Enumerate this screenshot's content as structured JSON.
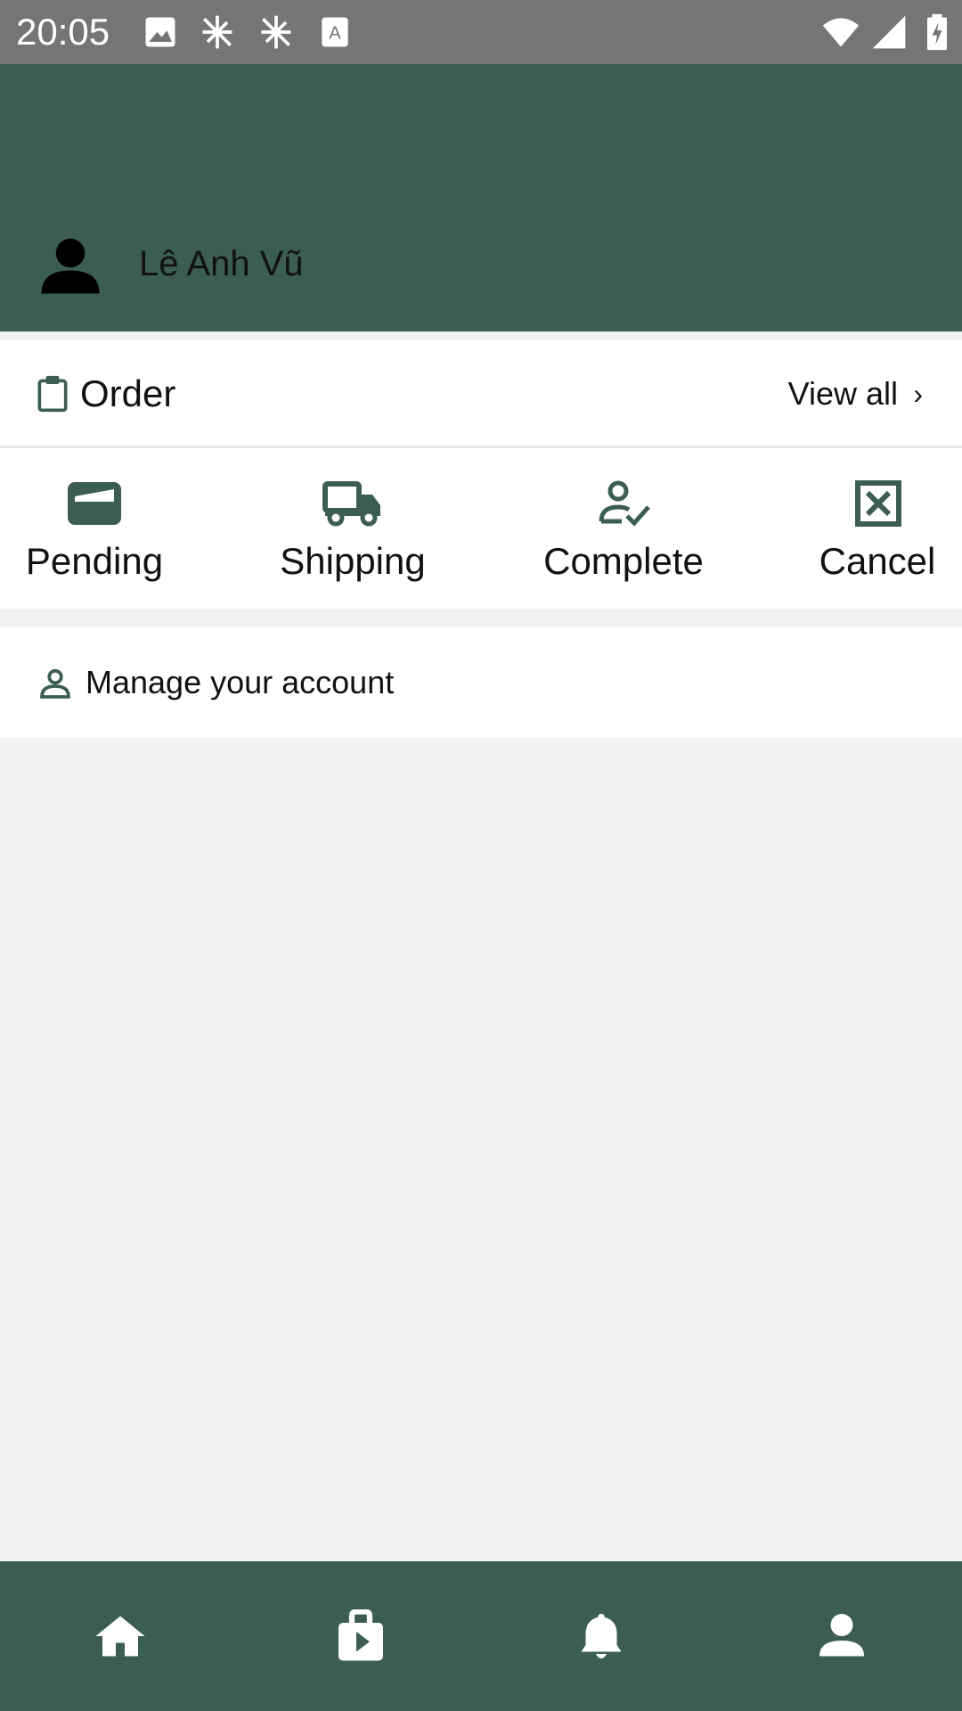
{
  "status_bar": {
    "time": "20:05",
    "icons": [
      "image-icon",
      "signal-off-icon",
      "signal-off-icon",
      "keyboard-a-icon",
      "wifi-icon",
      "cell-signal-icon",
      "battery-charging-icon"
    ]
  },
  "profile": {
    "name": "Lê Anh Vũ",
    "avatar_icon": "person-icon"
  },
  "order": {
    "title": "Order",
    "view_all": "View all",
    "chevron": "›",
    "statuses": [
      {
        "label": "Pending",
        "icon": "wallet-icon"
      },
      {
        "label": "Shipping",
        "icon": "truck-icon"
      },
      {
        "label": "Complete",
        "icon": "person-check-icon"
      },
      {
        "label": "Cancel",
        "icon": "box-x-icon"
      }
    ]
  },
  "account": {
    "label": "Manage your account",
    "icon": "person-outline-icon"
  },
  "bottom_nav": {
    "items": [
      "home-icon",
      "shop-bag-icon",
      "bell-icon",
      "profile-icon"
    ]
  },
  "colors": {
    "primary": "#3c5e50",
    "status_bar": "#757575",
    "background": "#f2f2f2"
  }
}
